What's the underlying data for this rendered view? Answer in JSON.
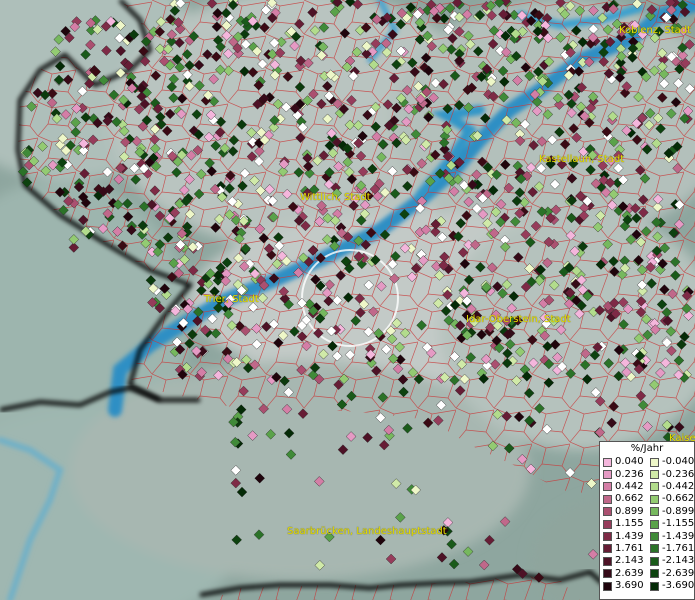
{
  "map": {
    "cities": [
      {
        "name": "Koblenz, Stadt"
      },
      {
        "name": "Kastellaun, Stadt"
      },
      {
        "name": "Wittlich, Stadt"
      },
      {
        "name": "Trier, Stadt"
      },
      {
        "name": "Idar-Oberstein, Stadt"
      },
      {
        "name": "Kaise"
      },
      {
        "name": "Saarbrücken, Landeshauptstadt"
      }
    ]
  },
  "legend": {
    "title": "%/Jahr",
    "positive": [
      {
        "label": "0.040",
        "color": "#f4b6dc"
      },
      {
        "label": "0.236",
        "color": "#e59ac4"
      },
      {
        "label": "0.442",
        "color": "#d47ea6"
      },
      {
        "label": "0.662",
        "color": "#c0688a"
      },
      {
        "label": "0.899",
        "color": "#ab5070"
      },
      {
        "label": "1.155",
        "color": "#963c5b"
      },
      {
        "label": "1.439",
        "color": "#7e2a46"
      },
      {
        "label": "1.761",
        "color": "#661d35"
      },
      {
        "label": "2.143",
        "color": "#4d1226"
      },
      {
        "label": "2.639",
        "color": "#360a18"
      },
      {
        "label": "3.690",
        "color": "#1f040c"
      }
    ],
    "negative": [
      {
        "label": "-0.040",
        "color": "#eef7c8"
      },
      {
        "label": "-0.236",
        "color": "#d0eaa8"
      },
      {
        "label": "-0.442",
        "color": "#b2dc8c"
      },
      {
        "label": "-0.662",
        "color": "#93cb72"
      },
      {
        "label": "-0.899",
        "color": "#76b85e"
      },
      {
        "label": "-1.155",
        "color": "#5aa24a"
      },
      {
        "label": "-1.439",
        "color": "#408a38"
      },
      {
        "label": "-1.761",
        "color": "#2b7228"
      },
      {
        "label": "-2.143",
        "color": "#1a5a1a"
      },
      {
        "label": "-2.639",
        "color": "#0d420f"
      },
      {
        "label": "-3.690",
        "color": "#042a06"
      }
    ]
  }
}
